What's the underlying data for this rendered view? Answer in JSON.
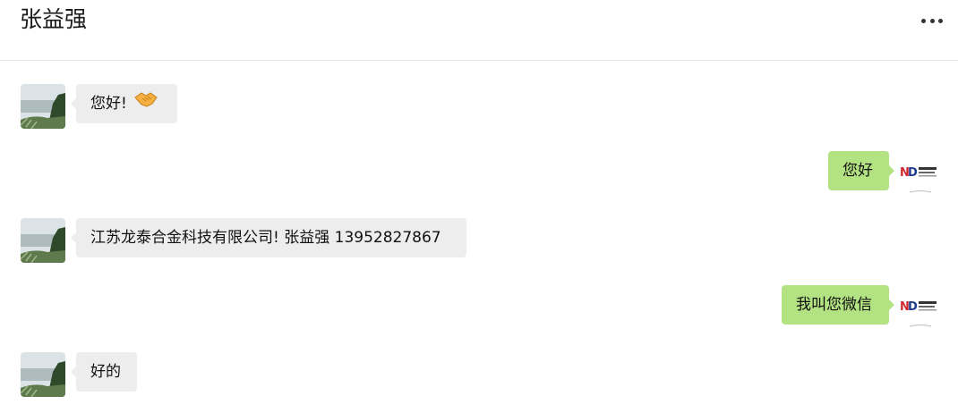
{
  "header": {
    "title": "张益强"
  },
  "messages": [
    {
      "side": "in",
      "text": "您好!",
      "emoji": "handshake-emoji"
    },
    {
      "side": "out",
      "text": "您好"
    },
    {
      "side": "in",
      "text": "江苏龙泰合金科技有限公司!  张益强 13952827867"
    },
    {
      "side": "out",
      "text": "我叫您微信"
    },
    {
      "side": "in",
      "text": "好的"
    }
  ],
  "colors": {
    "incoming_bubble": "#ededed",
    "outgoing_bubble": "#b2e281"
  }
}
